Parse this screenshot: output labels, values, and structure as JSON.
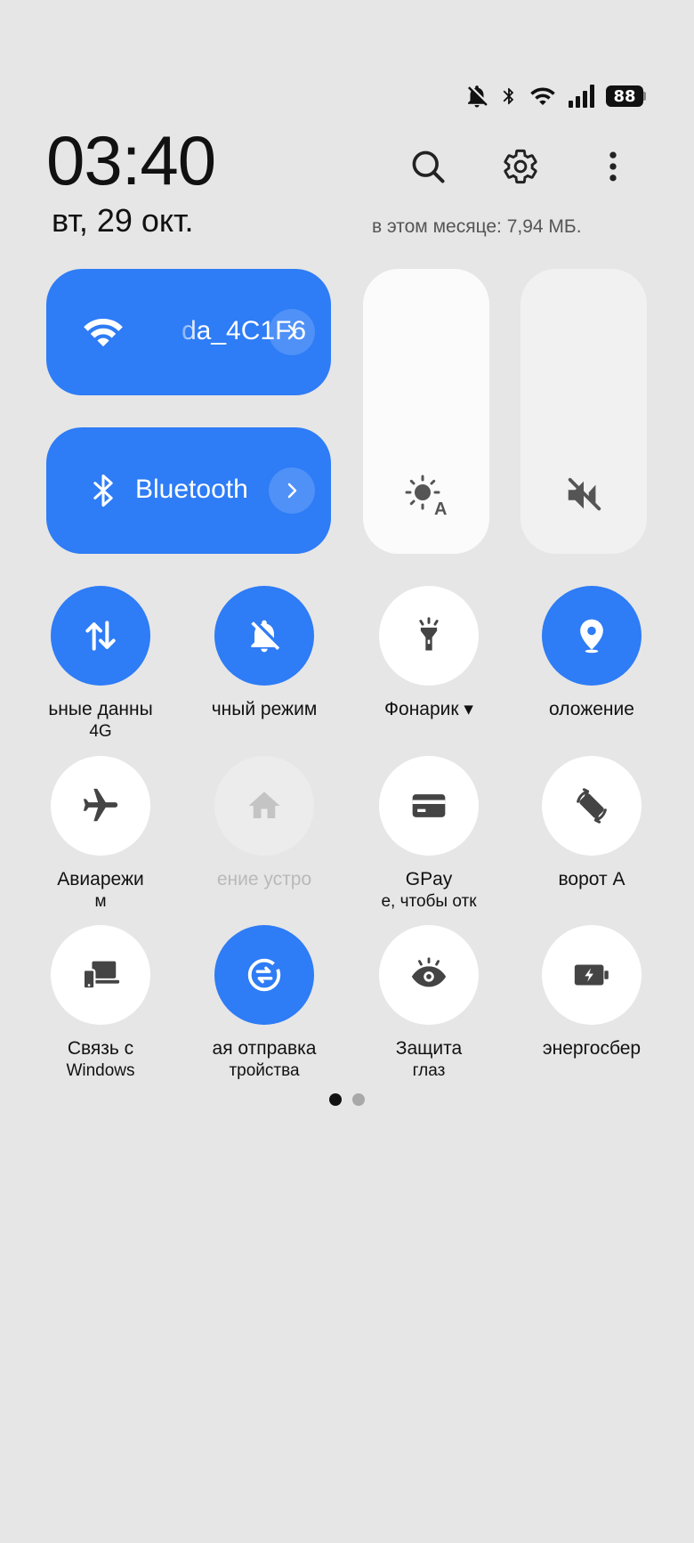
{
  "status_bar": {
    "battery": "88",
    "icons": [
      "bell-off-icon",
      "bluetooth-icon",
      "wifi-icon",
      "signal-icon",
      "battery-icon"
    ]
  },
  "header": {
    "time": "03:40",
    "date": "вт, 29 окт.",
    "data_usage": "в этом месяце: 7,94 МБ.",
    "icons": [
      "search-icon",
      "gear-icon",
      "more-vert-icon"
    ]
  },
  "big_tiles": {
    "wifi": {
      "label": "da_4C1F6",
      "icon": "wifi-icon"
    },
    "bluetooth": {
      "label": "Bluetooth",
      "icon": "bluetooth-icon"
    }
  },
  "sliders": {
    "brightness_icon": "auto-brightness-icon",
    "volume_icon": "volume-mute-icon"
  },
  "toggles": [
    {
      "label": "ьные данны",
      "sub": "4G",
      "state": "on",
      "icon": "mobile-data-icon"
    },
    {
      "label": "чный режим",
      "sub": "",
      "state": "on",
      "icon": "bell-off-icon"
    },
    {
      "label": "Фонарик ▾",
      "sub": "",
      "state": "off",
      "icon": "flashlight-icon"
    },
    {
      "label": "оложение",
      "sub": "",
      "state": "on",
      "icon": "location-icon"
    },
    {
      "label": "Авиарежи",
      "sub": "м",
      "state": "off",
      "icon": "airplane-icon"
    },
    {
      "label": "ение устро",
      "sub": "",
      "state": "disabled",
      "icon": "home-icon"
    },
    {
      "label": "GPay",
      "sub": "е, чтобы отк",
      "state": "off",
      "icon": "card-icon"
    },
    {
      "label": "ворот      А",
      "sub": "",
      "state": "off",
      "icon": "auto-rotate-icon"
    },
    {
      "label": "Связь с",
      "sub": "Windows",
      "state": "off",
      "icon": "link-windows-icon"
    },
    {
      "label": "ая отправка",
      "sub": "тройства",
      "state": "on",
      "icon": "nearby-share-icon"
    },
    {
      "label": "Защита",
      "sub": "глаз",
      "state": "off",
      "icon": "eye-icon"
    },
    {
      "label": "энергосбер",
      "sub": "",
      "state": "off",
      "icon": "battery-saver-icon"
    }
  ],
  "colors": {
    "background": "#e6e6e6",
    "accent": "#2e7cf6",
    "tile_off": "#ffffff"
  }
}
